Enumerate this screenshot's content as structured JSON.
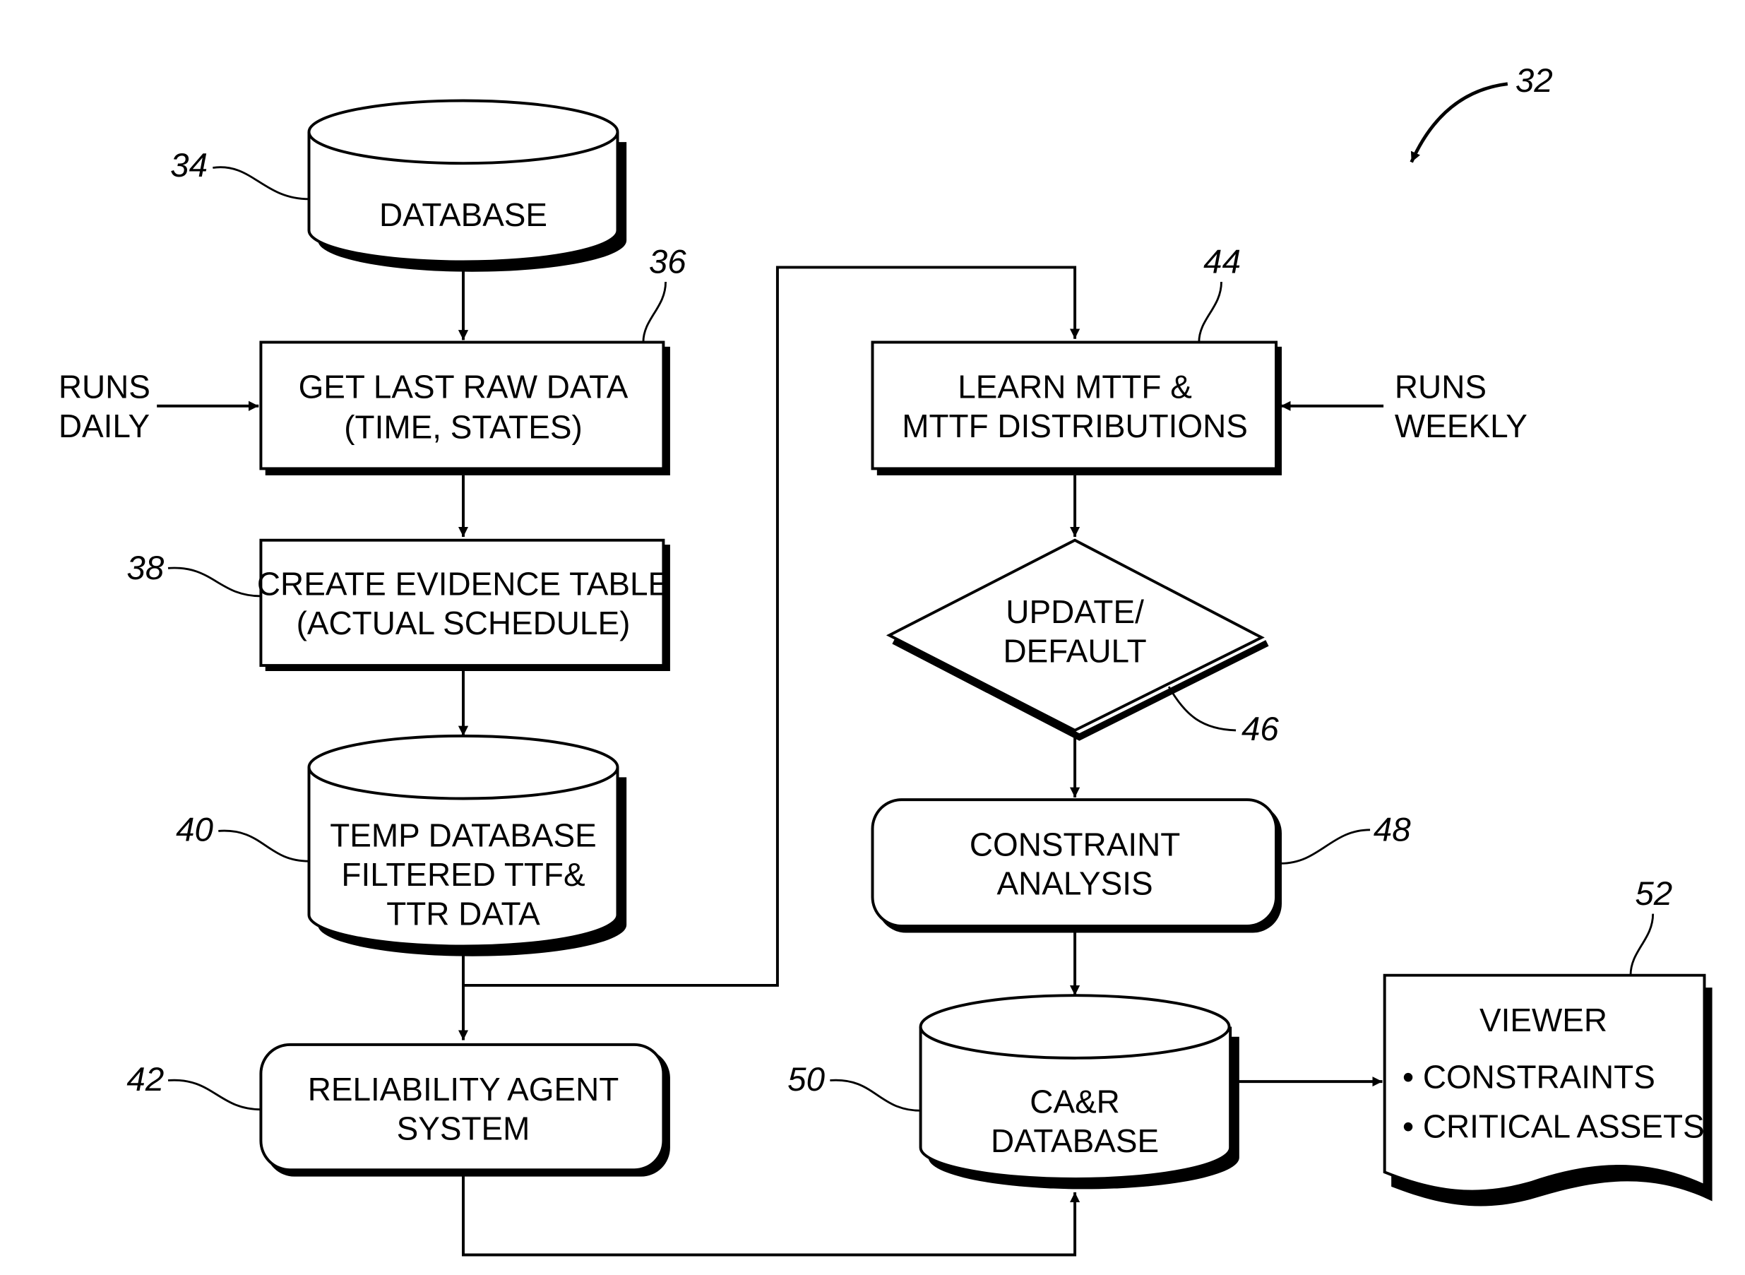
{
  "figure": {
    "ref": "32",
    "nodes": {
      "database": {
        "ref": "34",
        "lines": [
          "DATABASE"
        ]
      },
      "get_raw": {
        "ref": "36",
        "lines": [
          "GET LAST RAW DATA",
          "(TIME, STATES)"
        ]
      },
      "evidence": {
        "ref": "38",
        "lines": [
          "CREATE EVIDENCE TABLE",
          "(ACTUAL SCHEDULE)"
        ]
      },
      "temp_db": {
        "ref": "40",
        "lines": [
          "TEMP DATABASE",
          "FILTERED TTF&",
          "TTR DATA"
        ]
      },
      "agent": {
        "ref": "42",
        "lines": [
          "RELIABILITY AGENT",
          "SYSTEM"
        ]
      },
      "learn": {
        "ref": "44",
        "lines": [
          "LEARN MTTF &",
          "MTTF DISTRIBUTIONS"
        ]
      },
      "decision": {
        "ref": "46",
        "lines": [
          "UPDATE/",
          "DEFAULT"
        ]
      },
      "constraint": {
        "ref": "48",
        "lines": [
          "CONSTRAINT",
          "ANALYSIS"
        ]
      },
      "car_db": {
        "ref": "50",
        "lines": [
          "CA&R",
          "DATABASE"
        ]
      },
      "viewer": {
        "ref": "52",
        "title": "VIEWER",
        "bullets": [
          "• CONSTRAINTS",
          "• CRITICAL ASSETS"
        ]
      }
    },
    "inputs": {
      "daily": [
        "RUNS",
        "DAILY"
      ],
      "weekly": [
        "RUNS",
        "WEEKLY"
      ]
    }
  }
}
